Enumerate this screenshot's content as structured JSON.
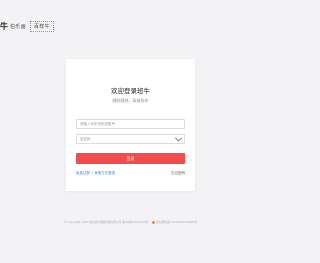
{
  "brand": {
    "logo": "牛",
    "slogan": "伯乐画",
    "tag": "百样牛"
  },
  "login": {
    "title": "欢迎登录班牛",
    "subtitle": "随时随地，高效协作",
    "phone_placeholder": "请输入手机号码或账号",
    "sms_placeholder": "验证码",
    "submit_label": "登录",
    "register_label": "免费注册",
    "separator": "|",
    "other_login_label": "其他方式登录",
    "forgot_label": "忘记密码"
  },
  "footer": {
    "copyright": "© Copyright 2020 杭州班牛网络科技有限公司 浙ICP备16023220号",
    "icp": "浙公网安备 33010602009888号"
  },
  "colors": {
    "accent": "#f24c4c",
    "link": "#3a7be3",
    "background": "#f3f3f5"
  }
}
